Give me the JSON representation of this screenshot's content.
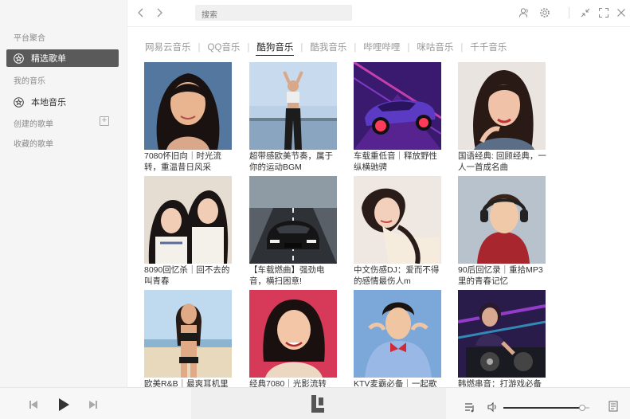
{
  "sidebar": {
    "section_platform": "平台聚合",
    "item_featured": "精选歌单",
    "section_my_music": "我的音乐",
    "item_local": "本地音乐",
    "section_created": "创建的歌单",
    "section_favorite": "收藏的歌单"
  },
  "topbar": {
    "search_placeholder": "搜索"
  },
  "tabs": [
    "网易云音乐",
    "QQ音乐",
    "酷狗音乐",
    "酷我音乐",
    "哔哩哔哩",
    "咪咕音乐",
    "千千音乐"
  ],
  "active_tab": 2,
  "playlists": [
    {
      "title": "7080怀旧向｜时光流转，重温昔日风采",
      "cover": "portrait-retro"
    },
    {
      "title": "超带感欧美节奏，属于你的运动BGM",
      "cover": "sport-girl"
    },
    {
      "title": "车载重低音｜释放野性纵横驰骋",
      "cover": "neon-car"
    },
    {
      "title": "国语经典: 回顾经典，一人一首成名曲",
      "cover": "woman-portrait"
    },
    {
      "title": "8090回忆杀｜回不去的叫青春",
      "cover": "two-girls"
    },
    {
      "title": "【车载燃曲】强劲电音，横扫困意!",
      "cover": "supercar"
    },
    {
      "title": "中文伤感DJ：爱而不得的感情最伤人m",
      "cover": "lying-girl"
    },
    {
      "title": "90后回忆录｜重拾MP3里的青春记忆",
      "cover": "headphone-boy"
    },
    {
      "title": "欧美R&B｜最爽耳机里",
      "cover": "beach-girl"
    },
    {
      "title": "经典7080｜光影流转",
      "cover": "classic-singer"
    },
    {
      "title": "KTV麦霸必备｜一起歌",
      "cover": "bowtie-man"
    },
    {
      "title": "韩燃串音：打游戏必备",
      "cover": "dj-deck"
    }
  ],
  "player": {
    "volume_percent": 92
  }
}
